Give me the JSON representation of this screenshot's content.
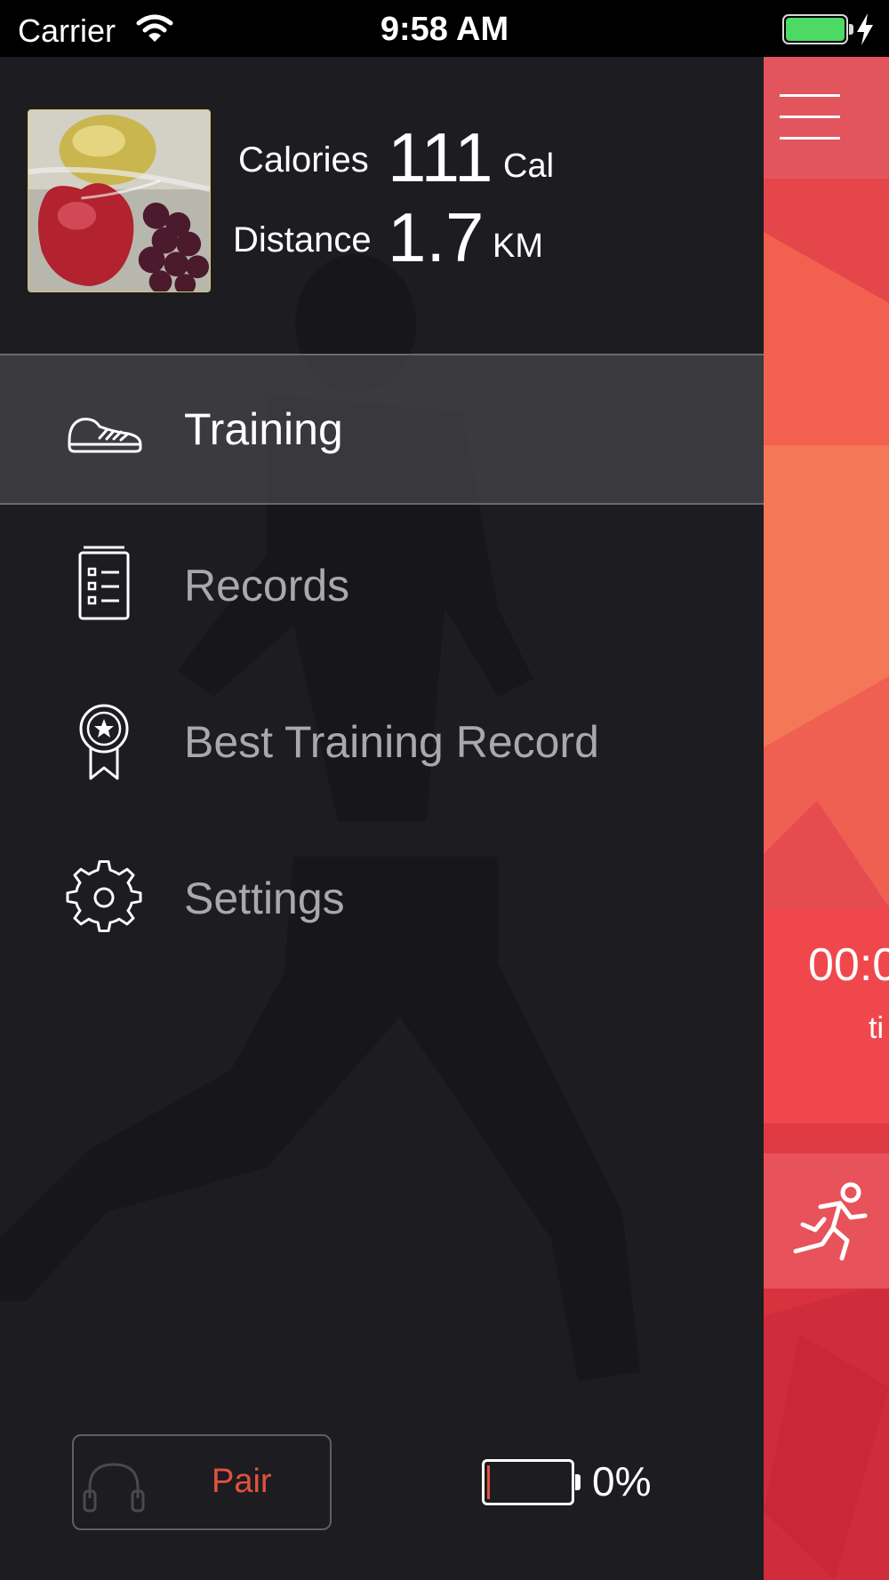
{
  "status_bar": {
    "carrier": "Carrier",
    "time": "9:58 AM"
  },
  "profile": {
    "calories_label": "Calories",
    "calories_value": "111",
    "calories_unit": "Cal",
    "distance_label": "Distance",
    "distance_value": "1.7",
    "distance_unit": "KM"
  },
  "menu": {
    "items": [
      {
        "label": "Training",
        "icon": "sneaker-icon",
        "active": true
      },
      {
        "label": "Records",
        "icon": "checklist-icon",
        "active": false
      },
      {
        "label": "Best Training Record",
        "icon": "award-ribbon-icon",
        "active": false
      },
      {
        "label": "Settings",
        "icon": "gear-icon",
        "active": false
      }
    ]
  },
  "footer": {
    "pair_label": "Pair",
    "battery_percent": "0%",
    "battery_level": 0
  },
  "main": {
    "timer_value": "00:0",
    "timer_label": "ti"
  },
  "colors": {
    "accent": "#e0523f",
    "drawer_bg": "#1d1c20",
    "main_red": "#d9323e"
  }
}
